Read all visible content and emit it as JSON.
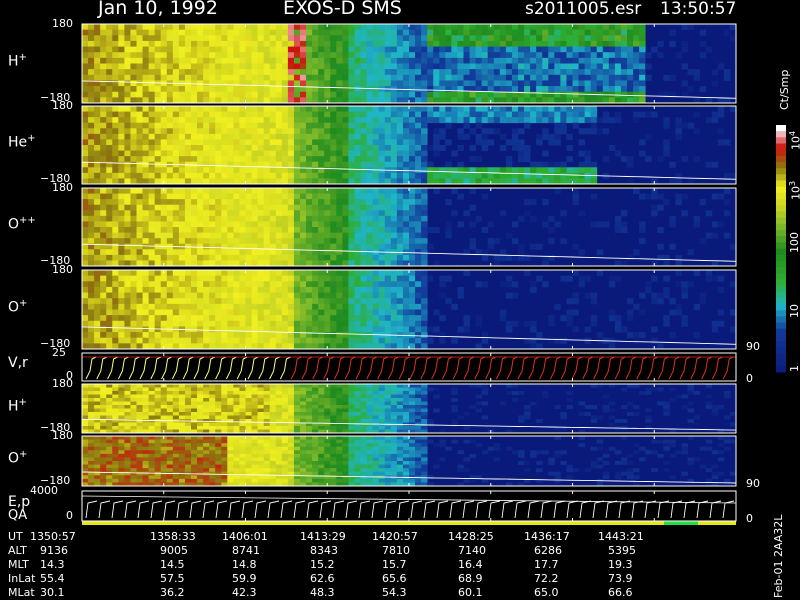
{
  "header": {
    "date": "Jan 10, 1992",
    "instrument": "EXOS-D SMS",
    "file": "s2011005.esr",
    "time": "13:50:57"
  },
  "panels": [
    {
      "label": "H",
      "sup": "+",
      "top_tick": "180",
      "bottom_tick": "−180"
    },
    {
      "label": "He",
      "sup": "+",
      "top_tick": "180",
      "bottom_tick": "−180"
    },
    {
      "label": "O",
      "sup": "++",
      "top_tick": "180",
      "bottom_tick": "−180"
    },
    {
      "label": "O",
      "sup": "+",
      "top_tick": "180",
      "bottom_tick": "−180",
      "right_tick": "90"
    },
    {
      "label": "V,r",
      "sup": "",
      "top_tick": "25",
      "bottom_tick": "0",
      "right_tick": "0"
    },
    {
      "label": "H",
      "sup": "+",
      "top_tick": "180",
      "bottom_tick": "−180"
    },
    {
      "label": "O",
      "sup": "+",
      "top_tick": "180",
      "bottom_tick": "−180",
      "right_tick": "90"
    },
    {
      "label": "E,p",
      "sup": "",
      "top_tick": "4000",
      "bottom_tick": "0",
      "right_tick": "0"
    }
  ],
  "qa_label": "QA",
  "colorbar": {
    "title": "Ct/Smp",
    "ticks": [
      "1",
      "10",
      "100",
      "10",
      "10"
    ],
    "tick_exps": [
      "",
      "",
      "",
      "3",
      "4"
    ]
  },
  "side_label": "Feb-01 2AA32L",
  "table": {
    "rows": [
      {
        "name": "UT",
        "values": [
          "1350:57",
          "1358:33",
          "1406:01",
          "1413:29",
          "1420:57",
          "1428:25",
          "1436:17",
          "1443:21"
        ]
      },
      {
        "name": "ALT",
        "values": [
          "9136",
          "9005",
          "8741",
          "8343",
          "7810",
          "7140",
          "6286",
          "5395"
        ]
      },
      {
        "name": "MLT",
        "values": [
          "14.3",
          "14.5",
          "14.8",
          "15.2",
          "15.7",
          "16.4",
          "17.7",
          "19.3"
        ]
      },
      {
        "name": "InLat",
        "values": [
          "55.4",
          "57.5",
          "59.9",
          "62.6",
          "65.6",
          "68.9",
          "72.2",
          "73.9"
        ]
      },
      {
        "name": "MLat",
        "values": [
          "30.1",
          "36.2",
          "42.3",
          "48.3",
          "54.3",
          "60.1",
          "65.0",
          "66.6"
        ]
      }
    ]
  },
  "chart_data": {
    "type": "heatmap",
    "title": "Jan 10, 1992   EXOS-D SMS",
    "x_tick_labels": [
      "1350:57",
      "1358:33",
      "1406:01",
      "1413:29",
      "1420:57",
      "1428:25",
      "1436:17",
      "1443:21"
    ],
    "ylim_pitch": [
      -180,
      180
    ],
    "ylim_vr": [
      0,
      25
    ],
    "ylim_ep": [
      0,
      4000
    ],
    "color_scale": "log",
    "color_range": [
      1,
      10000
    ],
    "color_unit": "Ct/Smp",
    "colors": {
      "low": "#0a1a7a",
      "mid_low": "#1fb5c8",
      "mid": "#2fae2f",
      "mid_high": "#e6e61a",
      "high": "#d01010",
      "max": "#ffffff",
      "qa_bar": "#e6e61a",
      "qa_flag": "#22dd44",
      "vr_trace_early": "#ffff80",
      "vr_trace_late": "#e03020"
    }
  }
}
